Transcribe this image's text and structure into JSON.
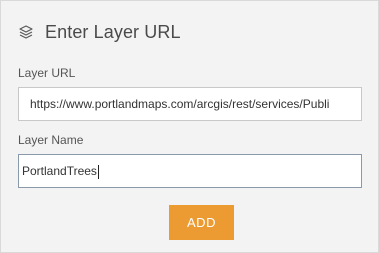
{
  "header": {
    "icon": "layers-icon",
    "title": "Enter Layer URL"
  },
  "form": {
    "url_label": "Layer URL",
    "url_value": "https://www.portlandmaps.com/arcgis/rest/services/Publi",
    "name_label": "Layer Name",
    "name_value": "PortlandTrees"
  },
  "actions": {
    "add_label": "ADD"
  },
  "colors": {
    "panel_bg": "#f3f3f3",
    "button_bg": "#ec9b32",
    "title_text": "#4a4a4a"
  }
}
